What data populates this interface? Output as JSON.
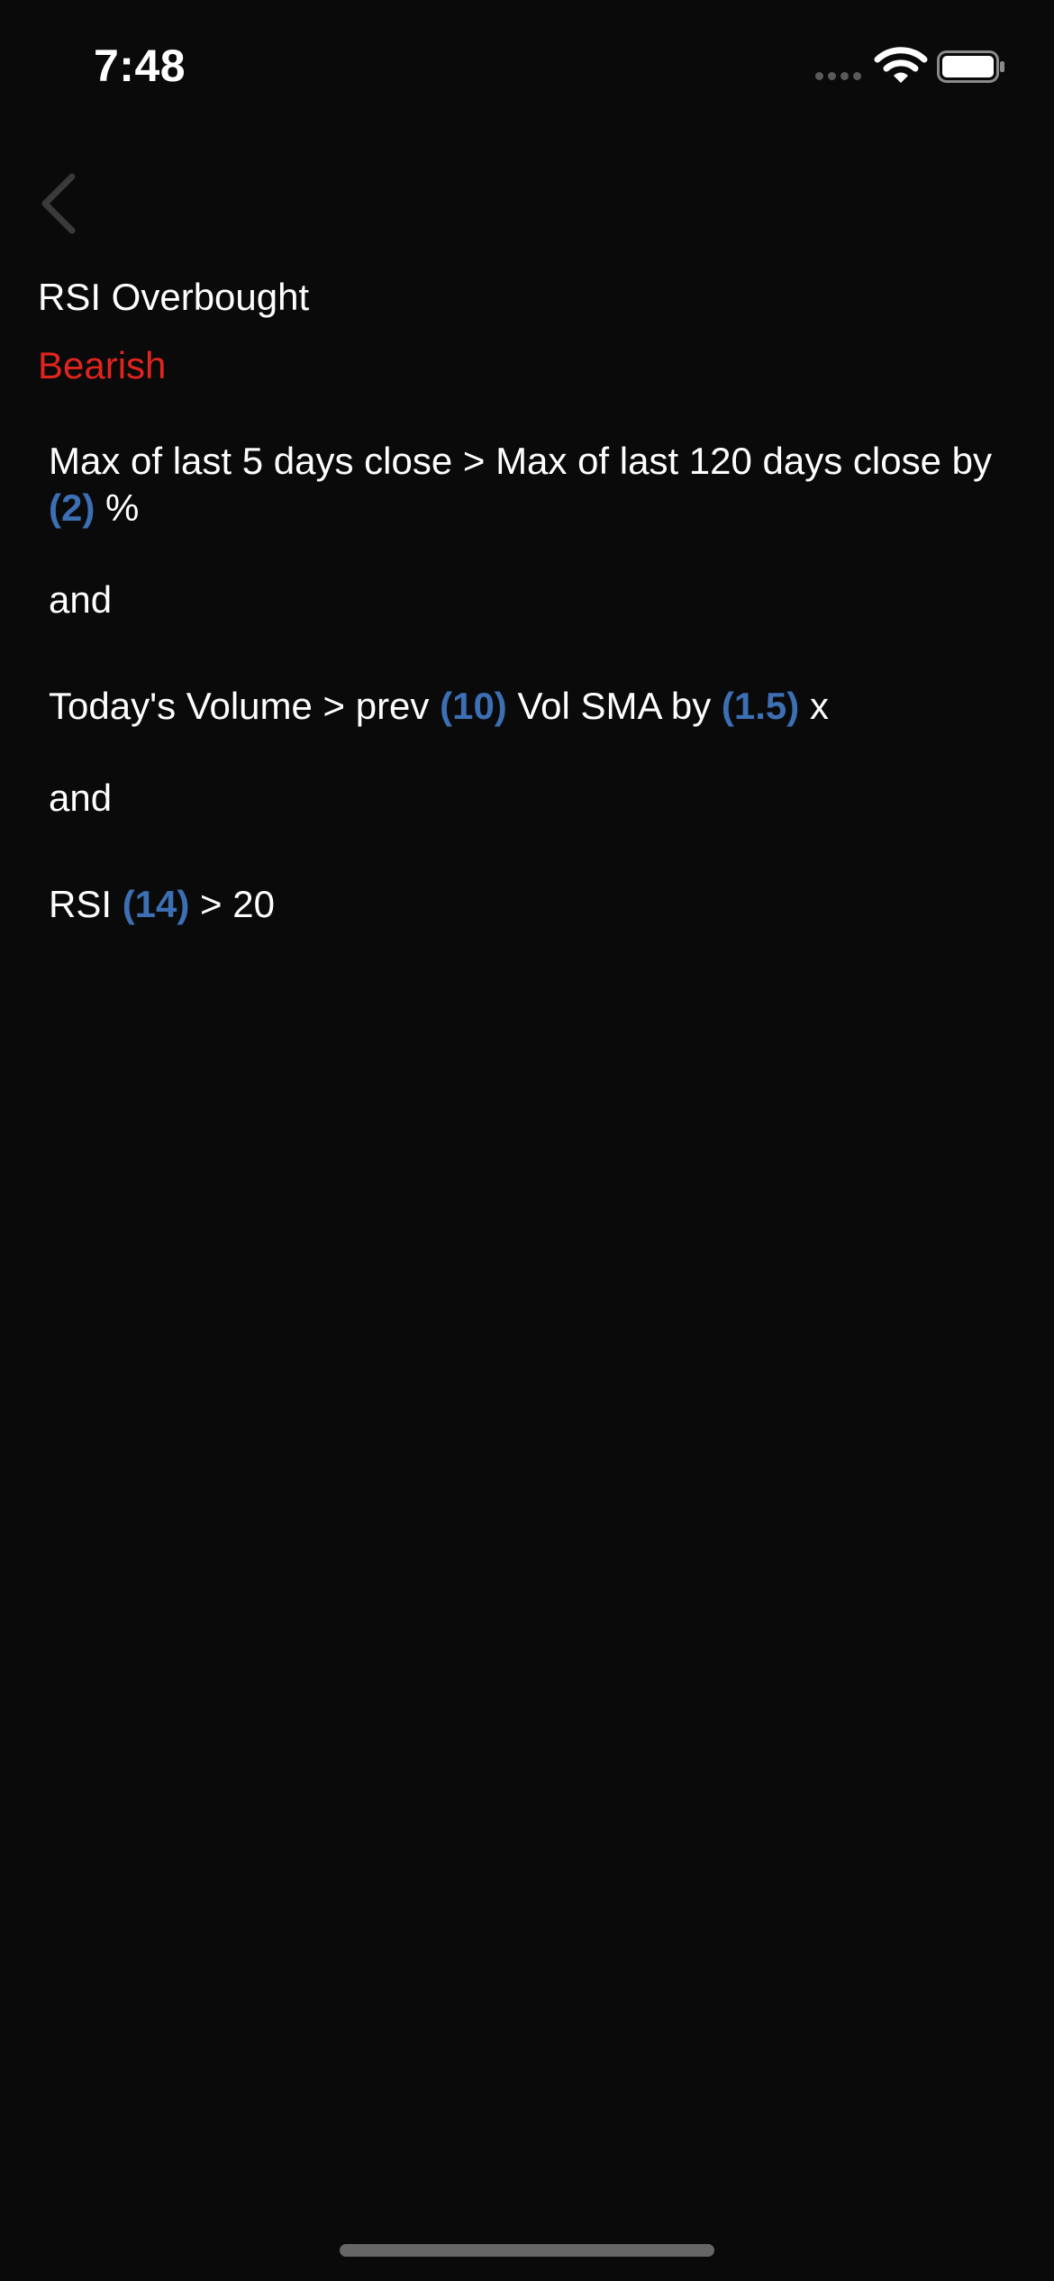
{
  "status_bar": {
    "time": "7:48",
    "icons": [
      "signal-dots-icon",
      "wifi-icon",
      "battery-icon"
    ]
  },
  "nav": {
    "back_icon": "chevron-left-icon"
  },
  "screener": {
    "title": "RSI Overbought",
    "sentiment": "Bearish",
    "sentiment_color": "#e0241f",
    "param_color": "#3c6fb4"
  },
  "conditions": [
    {
      "p1": "Max of last 5 days close > Max of last 120 days close by ",
      "v1": "(2)",
      "p2": " %"
    },
    {
      "connector": "and"
    },
    {
      "p1": "Today's Volume > prev ",
      "v1": "(10)",
      "p2": " Vol SMA by ",
      "v2": "(1.5)",
      "p3": " x"
    },
    {
      "connector": "and"
    },
    {
      "p1": "RSI ",
      "v1": "(14)",
      "p2": " > 20"
    }
  ]
}
